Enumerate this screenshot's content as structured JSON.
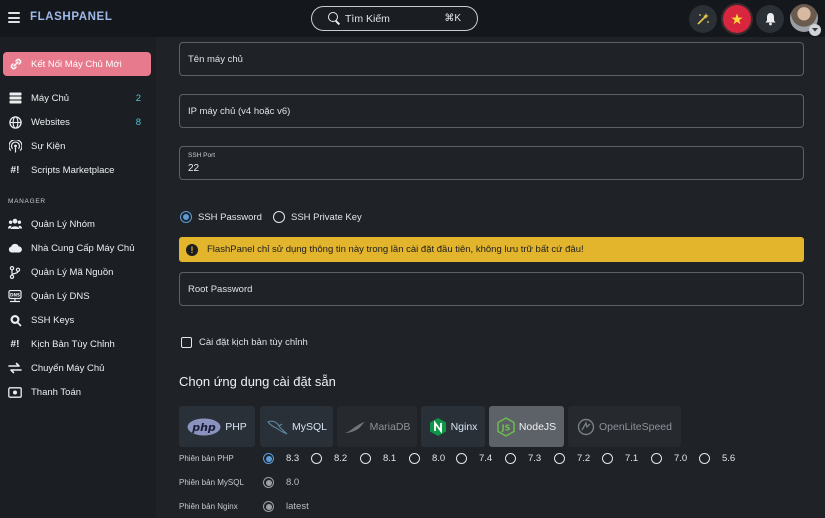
{
  "brand": "FLASHPANEL",
  "search": {
    "placeholder": "Tìm Kiếm",
    "shortcut": "⌘K"
  },
  "topbar_icons": [
    "magic-wand-icon",
    "vietnam-flag-icon",
    "bell-icon",
    "user-avatar"
  ],
  "sidebar": {
    "new_server": "Kết Nối Máy Chủ Mới",
    "items": [
      {
        "label": "Máy Chủ",
        "count": "2",
        "icon": "server-icon"
      },
      {
        "label": "Websites",
        "count": "8",
        "icon": "globe-icon"
      },
      {
        "label": "Sự Kiện",
        "icon": "broadcast-icon"
      },
      {
        "label": "Scripts Marketplace",
        "icon": "hashbang-icon"
      }
    ],
    "manager_label": "MANAGER",
    "manager_items": [
      {
        "label": "Quản Lý Nhóm",
        "icon": "users-icon"
      },
      {
        "label": "Nhà Cung Cấp Máy Chủ",
        "icon": "cloud-icon"
      },
      {
        "label": "Quản Lý Mã Nguồn",
        "icon": "git-branch-icon"
      },
      {
        "label": "Quản Lý DNS",
        "icon": "dns-icon"
      },
      {
        "label": "SSH Keys",
        "icon": "key-icon"
      },
      {
        "label": "Kịch Bản Tùy Chỉnh",
        "icon": "hashbang-icon"
      },
      {
        "label": "Chuyển Máy Chủ",
        "icon": "transfer-icon"
      },
      {
        "label": "Thanh Toán",
        "icon": "billing-icon"
      }
    ]
  },
  "form": {
    "server_name_placeholder": "Tên máy chủ",
    "server_ip_placeholder": "IP máy chủ (v4 hoặc v6)",
    "ssh_port_label": "SSH Port",
    "ssh_port_value": "22",
    "auth_options": [
      {
        "label": "SSH Password",
        "selected": true
      },
      {
        "label": "SSH Private Key",
        "selected": false
      }
    ],
    "warning": "FlashPanel chỉ sử dụng thông tin này trong lần cài đặt đầu tiên, không lưu trữ bất cứ đâu!",
    "root_password_placeholder": "Root Password",
    "custom_install_label": "Cài đặt kịch bản tùy chỉnh",
    "custom_install_checked": false
  },
  "apps_section": {
    "title": "Chọn ứng dụng cài đặt sẵn",
    "apps": [
      {
        "label": "PHP",
        "logo": "php-logo",
        "state": "enabled"
      },
      {
        "label": "MySQL",
        "logo": "mysql-dolphin-logo",
        "state": "enabled"
      },
      {
        "label": "MariaDB",
        "logo": "mariadb-seal-logo",
        "state": "disabled"
      },
      {
        "label": "Nginx",
        "logo": "nginx-logo",
        "state": "enabled"
      },
      {
        "label": "NodeJS",
        "logo": "nodejs-logo",
        "state": "selected"
      },
      {
        "label": "OpenLiteSpeed",
        "logo": "openlitespeed-logo",
        "state": "disabled"
      }
    ]
  },
  "versions": {
    "php": {
      "label": "Phiên bản PHP",
      "options": [
        "8.3",
        "8.2",
        "8.1",
        "8.0",
        "7.4",
        "7.3",
        "7.2",
        "7.1",
        "7.0",
        "5.6"
      ],
      "selected": "8.3"
    },
    "mysql": {
      "label": "Phiên bản MySQL",
      "options": [
        "8.0"
      ],
      "selected": "8.0"
    },
    "nginx": {
      "label": "Phiên bản Nginx",
      "options": [
        "latest"
      ],
      "selected": "latest"
    }
  },
  "colors": {
    "accent_pink": "#e77a8d",
    "warning_yellow": "#e3b52c",
    "count_teal": "#4fc3d6",
    "radio_blue": "#5a9bd8"
  }
}
